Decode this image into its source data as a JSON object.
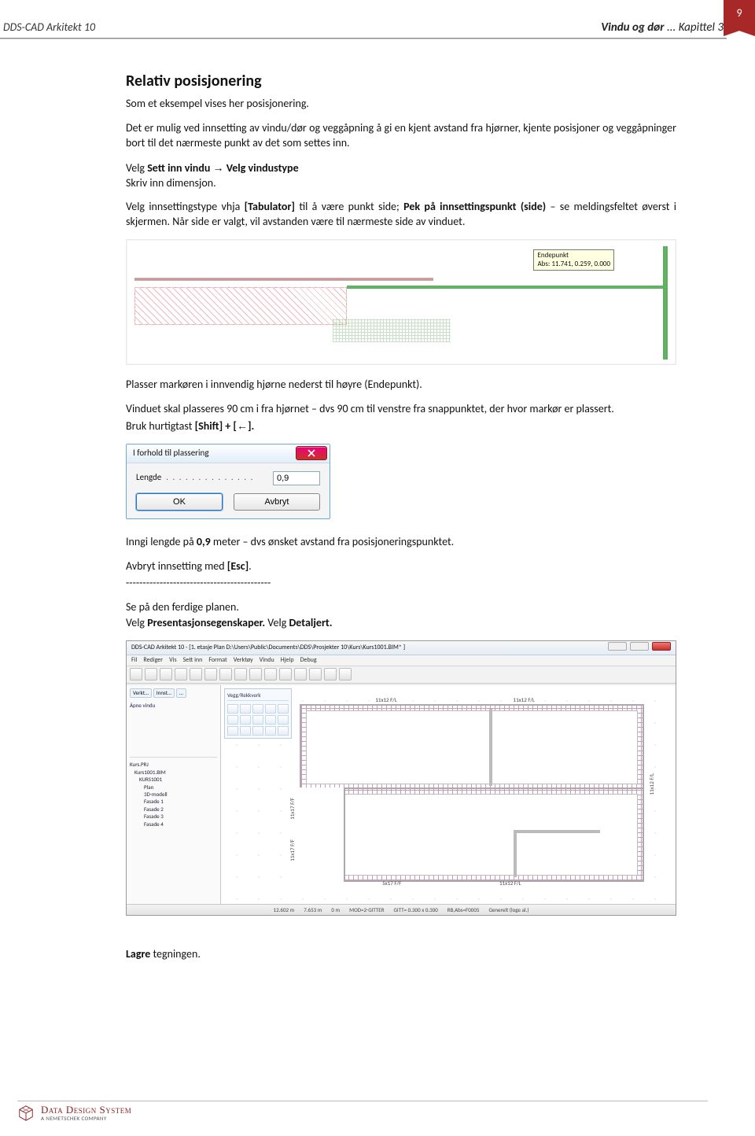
{
  "page_number": "9",
  "header_left": "DDS-CAD Arkitekt 10",
  "header_right_bold": "Vindu og dør",
  "header_right_rest": " ... Kapittel 3",
  "h2": "Relativ posisjonering",
  "p1": "Som et eksempel vises her posisjonering.",
  "p2": "Det er mulig ved innsetting av vindu/dør og veggåpning å gi en kjent avstand fra hjørner, kjente posisjoner og veggåpninger bort til det nærmeste punkt av det som settes inn.",
  "p3a": "Velg ",
  "p3b": "Sett inn vindu",
  "arrow_right": "→",
  "p3c": "Velg vindustype",
  "p4": "Skriv inn dimensjon.",
  "p5_a": "Velg innsettingstype vhja ",
  "p5_b": "[Tabulator]",
  "p5_c": " til å være punkt side; ",
  "p5_d": "Pek på innsettingspunkt (side)",
  "p5_e": " – se meldingsfeltet øverst i skjermen. Når side er valgt, vil avstanden være til nærmeste side av vinduet.",
  "tooltip_title": "Endepunkt",
  "tooltip_coords": "Abs: 11.741, 0.259, 0.000",
  "p6": "Plasser markøren i innvendig hjørne nederst til høyre (Endepunkt).",
  "p7": "Vinduet skal plasseres 90 cm i fra hjørnet – dvs  90 cm til venstre fra snappunktet, der hvor markør er plassert.",
  "p8_a": "Bruk hurtigtast ",
  "p8_b": "[Shift] + [",
  "arrow_left": "←",
  "p8_c": "].",
  "dialog": {
    "title": "I forhold til plassering",
    "label": "Lengde",
    "value": "0,9",
    "ok": "OK",
    "cancel": "Avbryt"
  },
  "p9_a": "Inngi lengde på ",
  "p9_b": "0,9",
  "p9_c": " meter – dvs ønsket avstand fra posisjoneringspunktet.",
  "p10_a": "Avbryt innsetting med ",
  "p10_b": "[Esc]",
  "p10_c": ".",
  "dashes": "-------------------------------------------",
  "p11": "Se på den ferdige planen.",
  "p12_a": "Velg ",
  "p12_b": "Presentasjonsegenskaper.",
  "p12_c": "   Velg ",
  "p12_d": "Detaljert.",
  "app": {
    "title": "DDS-CAD Arkitekt 10 - [1. etasje  Plan  D:\\Users\\Public\\Documents\\DDS\\Prosjekter 10\\Kurs\\Kurs1001.BIM* ]",
    "menus": [
      "Fil",
      "Rediger",
      "Vis",
      "Sett inn",
      "Format",
      "Verktøy",
      "Vindu",
      "Hjelp",
      "Debug"
    ],
    "left_tabs": [
      "Verkt…",
      "Innst…",
      "…"
    ],
    "left_item": "Åpne vindu",
    "tree": [
      "Kurs.PRJ",
      "Kurs1001.BIM",
      "KURS1001",
      "Plan",
      "3D-modell",
      "Fasade 1",
      "Fasade 2",
      "Fasade 3",
      "Fasade 4"
    ],
    "toolbox_header": "Vegg/Rekkverk",
    "plan_labels": {
      "top_left": "11x12 F/L",
      "top_right": "11x12 F/L",
      "right": "11x12 F/L",
      "left_upper": "11x17 F/F",
      "left_lower": "11x17 F/F",
      "bottom_left": "5x17 F/F",
      "bottom_right": "11x12 F/L"
    },
    "status": [
      "12.602 m",
      "7.653 m",
      "0 m",
      "MOD=2-GITTER",
      "GITT= 0.300 x 0.300",
      "RB,Abs=F0005",
      "Generelt (loge al.)"
    ]
  },
  "p_last_a": "Lagre",
  "p_last_b": " tegningen.",
  "footer_brand": "Data Design System",
  "footer_sub": "A NEMETSCHEK COMPANY"
}
